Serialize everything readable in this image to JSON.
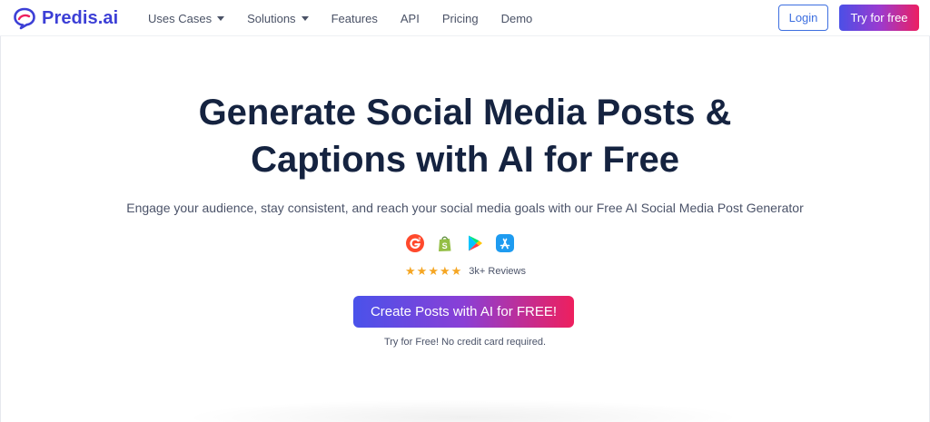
{
  "brand": {
    "name": "Predis.ai",
    "icon": "speech-bubble-logo-icon"
  },
  "nav": {
    "items": [
      {
        "label": "Uses Cases",
        "dropdown": true
      },
      {
        "label": "Solutions",
        "dropdown": true
      },
      {
        "label": "Features",
        "dropdown": false
      },
      {
        "label": "API",
        "dropdown": false
      },
      {
        "label": "Pricing",
        "dropdown": false
      },
      {
        "label": "Demo",
        "dropdown": false
      }
    ],
    "login_label": "Login",
    "try_label": "Try for free"
  },
  "hero": {
    "title_line1": "Generate Social Media Posts &",
    "title_line2": "Captions with AI for Free",
    "subtitle": "Engage your audience, stay consistent, and reach your social media goals with our Free AI Social Media Post Generator",
    "badges": [
      "g2-icon",
      "shopify-icon",
      "google-play-icon",
      "app-store-icon"
    ],
    "rating": {
      "stars": 5,
      "reviews_label": "3k+ Reviews"
    },
    "cta_label": "Create Posts with AI for FREE!",
    "cta_note": "Try for Free! No credit card required."
  },
  "colors": {
    "brand": "#3c3fd6",
    "title": "#152340",
    "gradient_start": "#4a52ea",
    "gradient_end": "#ee1f5e",
    "star": "#f5a623"
  }
}
